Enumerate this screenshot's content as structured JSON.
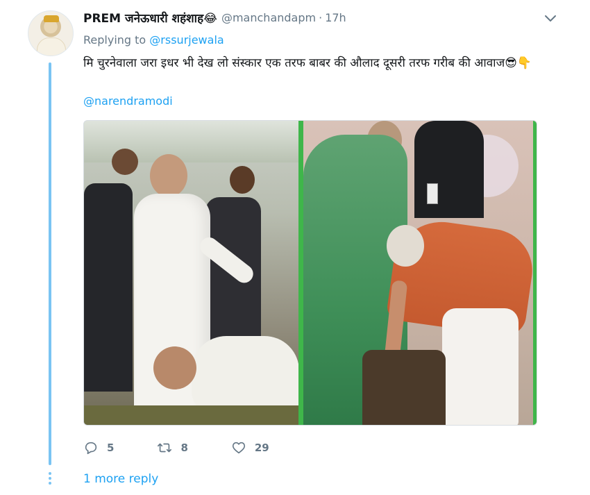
{
  "tweet": {
    "display_name": "PREM जनेऊधारी शहंशाह😂",
    "handle": "@manchandapm",
    "separator": "·",
    "time": "17h",
    "replying_prefix": "Replying to ",
    "replying_to": "@rssurjewala",
    "text": "मि चुरनेवाला जरा इधर भी देख लो संस्कार एक तरफ बाबर की औलाद दूसरी तरफ गरीब की आवाज😎👇",
    "mention": "@narendramodi"
  },
  "actions": {
    "reply_count": "5",
    "retweet_count": "8",
    "like_count": "29"
  },
  "footer": {
    "more_replies": "1 more reply"
  },
  "colors": {
    "link": "#1da1f2",
    "muted": "#657786",
    "thread_line": "#7ac4f3",
    "photo_border": "#3fb64a"
  },
  "icons": [
    "chevron-down-icon",
    "reply-icon",
    "retweet-icon",
    "like-icon"
  ]
}
